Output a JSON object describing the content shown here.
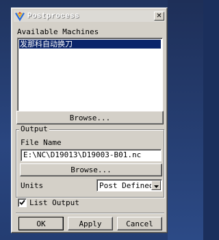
{
  "window": {
    "title": "Postprocess",
    "close_glyph": "✕",
    "icon": "app-icon"
  },
  "machines": {
    "label": "Available Machines",
    "items": [
      "发那科自动换刀"
    ],
    "selected_index": 0,
    "browse_label": "Browse..."
  },
  "output": {
    "group_label": "Output",
    "file_name_label": "File Name",
    "file_name_value": "E:\\NC\\D19013\\D19003-B01.nc",
    "browse_label": "Browse...",
    "units_label": "Units",
    "units_value": "Post Defined"
  },
  "list_output": {
    "label": "List Output",
    "checked": true
  },
  "footer": {
    "ok_label": "OK",
    "apply_label": "Apply",
    "cancel_label": "Cancel"
  },
  "colors": {
    "selection": "#0a246a",
    "face": "#d4d0c8",
    "desktop": "#2a4680"
  }
}
